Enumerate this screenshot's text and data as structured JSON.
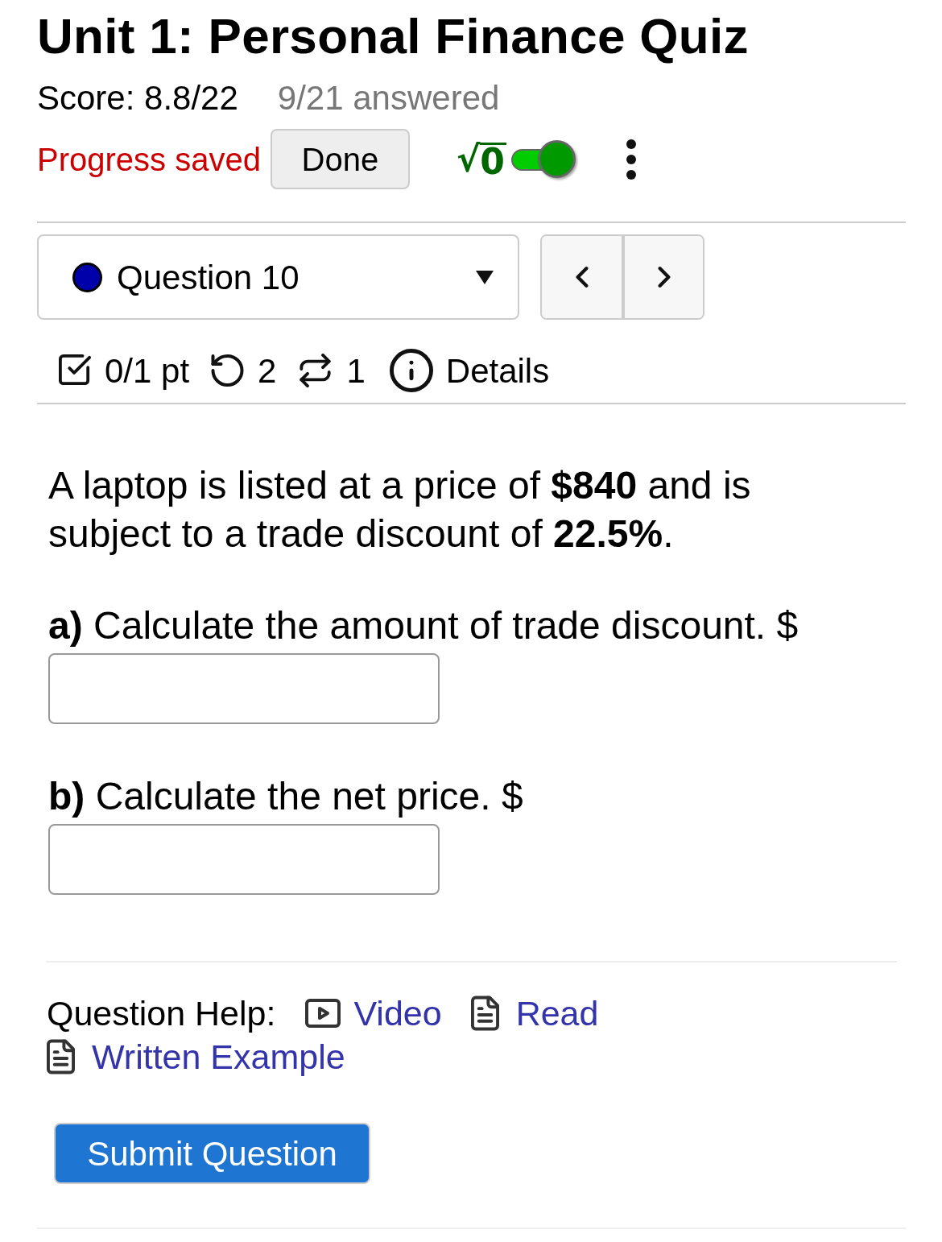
{
  "header": {
    "title": "Unit 1: Personal Finance Quiz",
    "score": "Score: 8.8/22",
    "answered": "9/21 answered"
  },
  "toolbar": {
    "status": "Progress saved",
    "done_button": "Done",
    "math_toggle": {
      "radical": "√",
      "radicand": "0",
      "on": true
    }
  },
  "question_select": {
    "label": "Question 10",
    "color": "#0000aa"
  },
  "question_meta": {
    "points": "0/1 pt",
    "attempts": "2",
    "versions": "1",
    "details": "Details"
  },
  "question": {
    "text": "A laptop is listed at a price of **$840** and is subject to a trade discount of **22.5%**.",
    "parts": [
      {
        "prompt": "**a)** Calculate the amount of trade discount. $"
      },
      {
        "prompt": "**b)** Calculate the net price. $"
      }
    ]
  },
  "help": {
    "label": "Question Help:",
    "links": [
      {
        "label": "Video",
        "kind": "video"
      },
      {
        "label": "Read",
        "kind": "document"
      },
      {
        "label": "Written Example",
        "kind": "document"
      }
    ]
  },
  "submit_button": "Submit Question"
}
